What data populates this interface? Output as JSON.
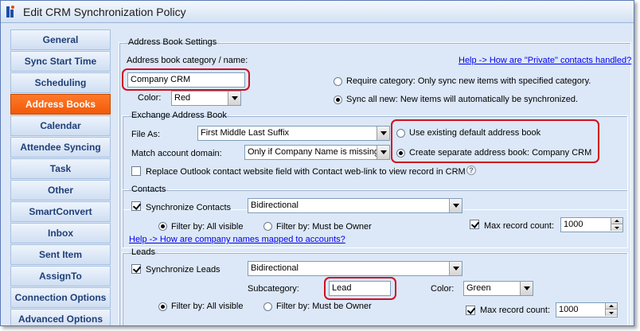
{
  "window": {
    "title": "Edit CRM Synchronization Policy"
  },
  "sidebar": {
    "items": [
      {
        "label": "General"
      },
      {
        "label": "Sync Start Time"
      },
      {
        "label": "Scheduling"
      },
      {
        "label": "Address Books",
        "active": true
      },
      {
        "label": "Calendar"
      },
      {
        "label": "Attendee Syncing"
      },
      {
        "label": "Task"
      },
      {
        "label": "Other"
      },
      {
        "label": "SmartConvert"
      },
      {
        "label": "Inbox"
      },
      {
        "label": "Sent Item"
      },
      {
        "label": "AssignTo"
      },
      {
        "label": "Connection Options"
      },
      {
        "label": "Advanced Options"
      }
    ]
  },
  "address_book_settings": {
    "legend": "Address Book Settings",
    "category_label": "Address book category / name:",
    "category_value": "Company CRM",
    "help_link": "Help -> How are \"Private\" contacts handled?",
    "color_label": "Color:",
    "color_value": "Red",
    "radio_require": "Require category: Only sync new items with specified category.",
    "radio_sync_all": "Sync all new: New items will automatically be synchronized."
  },
  "exchange_address_book": {
    "legend": "Exchange Address Book",
    "file_as_label": "File As:",
    "file_as_value": "First Middle Last Suffix",
    "match_label": "Match account domain:",
    "match_value": "Only if Company Name is missing",
    "radio_existing": "Use existing default address book",
    "radio_separate": "Create separate address book: Company CRM",
    "replace_website": "Replace Outlook contact website field with Contact web-link to view record in CRM"
  },
  "contacts": {
    "legend": "Contacts",
    "sync_label": "Synchronize Contacts",
    "direction_value": "Bidirectional",
    "filter_all": "Filter by: All visible",
    "filter_owner": "Filter by: Must be Owner",
    "max_label": "Max record count:",
    "max_value": "1000",
    "help_link": "Help -> How are company names mapped to accounts?"
  },
  "leads": {
    "legend": "Leads",
    "sync_label": "Synchronize Leads",
    "direction_value": "Bidirectional",
    "subcategory_label": "Subcategory:",
    "subcategory_value": "Lead",
    "color_label": "Color:",
    "color_value": "Green",
    "filter_all": "Filter by: All visible",
    "filter_owner": "Filter by: Must be Owner",
    "max_label": "Max record count:",
    "max_value": "1000"
  },
  "colors": {
    "active_tab": "#f05a08",
    "highlight": "#d01020",
    "link": "#0000ee"
  }
}
